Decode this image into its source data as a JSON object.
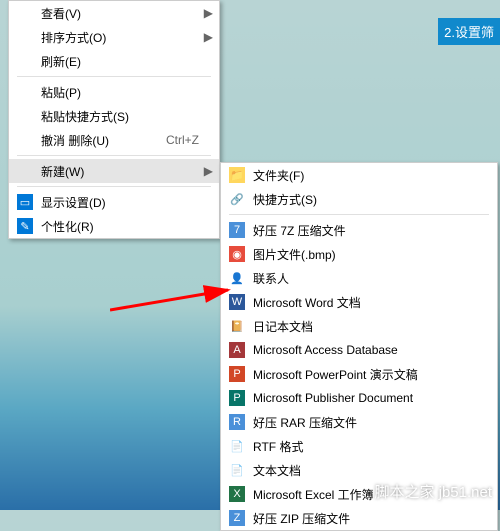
{
  "menu1": {
    "view": "查看(V)",
    "sort": "排序方式(O)",
    "refresh": "刷新(E)",
    "paste": "粘贴(P)",
    "paste_shortcut": "粘贴快捷方式(S)",
    "undo_delete": "撤消 删除(U)",
    "undo_key": "Ctrl+Z",
    "new": "新建(W)",
    "display": "显示设置(D)",
    "personalize": "个性化(R)"
  },
  "menu2": {
    "folder": "文件夹(F)",
    "shortcut": "快捷方式(S)",
    "haozip7z": "好压 7Z 压缩文件",
    "bmp": "图片文件(.bmp)",
    "contact": "联系人",
    "word": "Microsoft Word 文档",
    "diary": "日记本文档",
    "access": "Microsoft Access Database",
    "ppt": "Microsoft PowerPoint 演示文稿",
    "publisher": "Microsoft Publisher Document",
    "haozip_rar": "好压 RAR 压缩文件",
    "rtf": "RTF 格式",
    "txt": "文本文档",
    "excel": "Microsoft Excel 工作簿",
    "haozip_zip": "好压 ZIP 压缩文件"
  },
  "callout": "2.设置筛",
  "watermark": "脚本之家 jb51.net",
  "arrow": "▶"
}
